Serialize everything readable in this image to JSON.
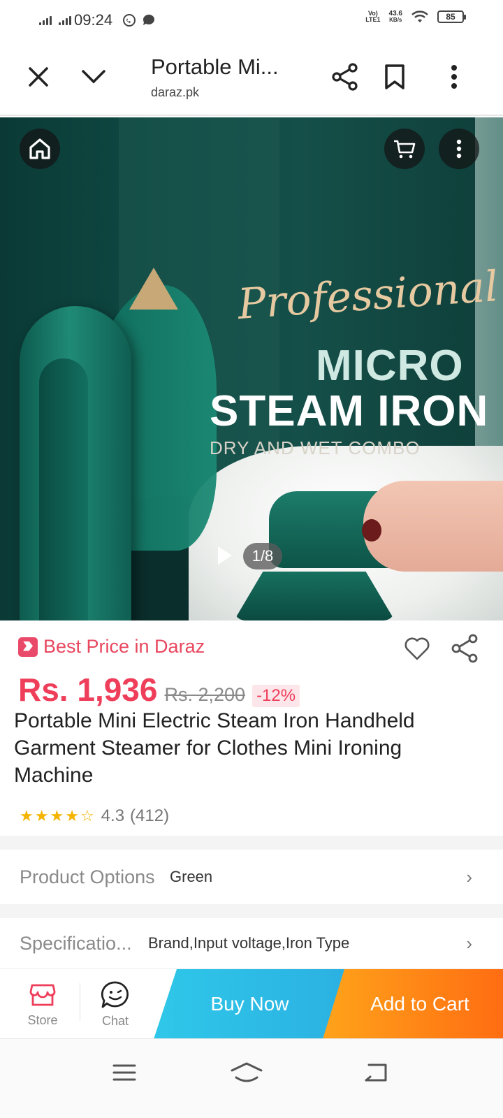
{
  "status_bar": {
    "time": "09:24",
    "network_label_top": "Vo)",
    "network_label_bottom": "LTE1",
    "speed_value": "43.6",
    "speed_unit": "KB/s",
    "battery": "85"
  },
  "browser": {
    "page_title": "Portable Mi...",
    "domain": "daraz.pk"
  },
  "hero": {
    "script_text": "Professional",
    "headline_1": "MICRO",
    "headline_2": "STEAM IRON",
    "subline": "DRY AND WET COMBO",
    "page_indicator": "1/8"
  },
  "product": {
    "badge": "Best Price in Daraz",
    "price": "Rs. 1,936",
    "original_price": "Rs. 2,200",
    "discount": "-12%",
    "title": "Portable Mini Electric Steam Iron Handheld Garment Steamer for Clothes Mini Ironing Machine",
    "rating": "4.3",
    "rating_count": "(412)",
    "stars_value": 4.3
  },
  "options": {
    "product_options_label": "Product Options",
    "product_options_value": "Green",
    "specification_label": "Specificatio...",
    "specification_value": "Brand,Input voltage,Iron Type"
  },
  "action_bar": {
    "store_label": "Store",
    "chat_label": "Chat",
    "buy_now": "Buy Now",
    "add_to_cart": "Add to Cart"
  },
  "colors": {
    "price_red": "#ef3e5a",
    "buy_now_blue": "#2bb1e2",
    "add_cart_orange": "#ff6d12"
  }
}
